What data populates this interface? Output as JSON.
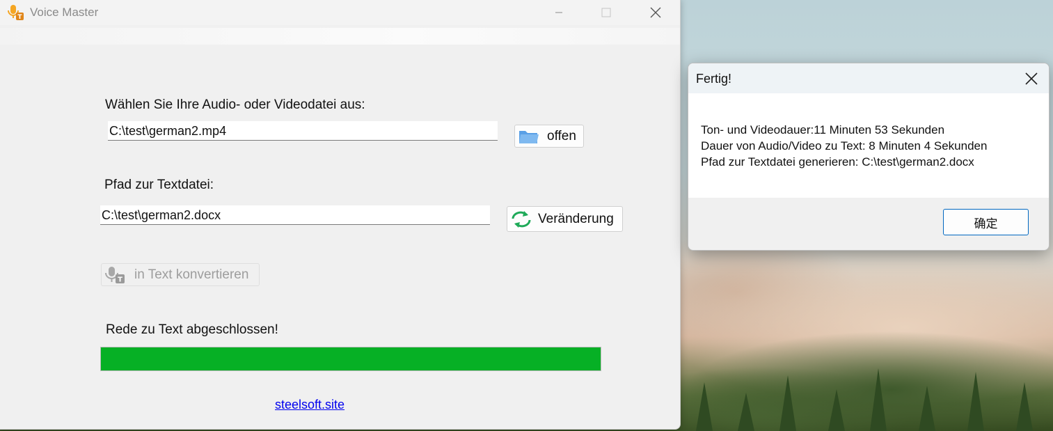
{
  "window": {
    "title": "Voice Master",
    "icon": "app-microphone-icon"
  },
  "controls": {
    "minimize_icon": "minimize-icon",
    "maximize_icon": "maximize-icon",
    "close_icon": "close-icon"
  },
  "input_section": {
    "label": "Wählen Sie Ihre Audio- oder Videodatei aus:",
    "value": "C:\\test\\german2.mp4",
    "button_label": "offen",
    "button_icon": "folder-icon"
  },
  "output_section": {
    "label": "Pfad zur Textdatei:",
    "value": "C:\\test\\german2.docx",
    "button_label": "Veränderung",
    "button_icon": "refresh-icon"
  },
  "convert_button": {
    "label": "in Text konvertieren",
    "icon": "microphone-text-icon",
    "enabled": false
  },
  "status": {
    "text": "Rede zu Text abgeschlossen!",
    "progress": 1.0,
    "progress_color": "#06b025"
  },
  "footer": {
    "link_text": "steelsoft.site"
  },
  "dialog": {
    "title": "Fertig!",
    "lines": [
      "Ton- und Videodauer:11 Minuten 53 Sekunden",
      "Dauer von Audio/Video zu Text: 8 Minuten 4 Sekunden",
      "Pfad zur Textdatei generieren: C:\\test\\german2.docx"
    ],
    "ok_label": "确定",
    "accent_color": "#0067c0"
  }
}
